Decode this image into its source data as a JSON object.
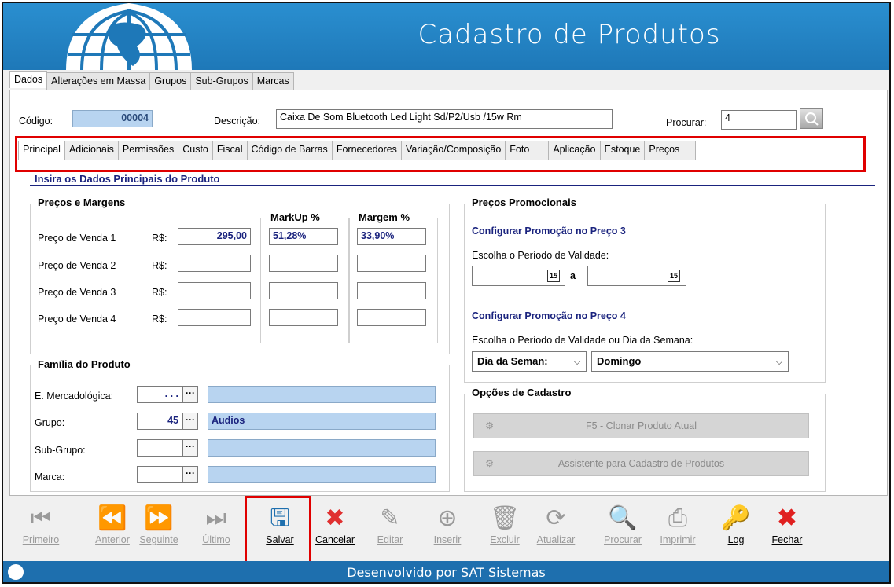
{
  "header": {
    "title": "Cadastro de Produtos"
  },
  "main_tabs": [
    "Dados",
    "Alterações em Massa",
    "Grupos",
    "Sub-Grupos",
    "Marcas"
  ],
  "form": {
    "codigo_label": "Código:",
    "codigo_value": "00004",
    "descricao_label": "Descrição:",
    "descricao_value": "Caixa De Som Bluetooth Led Light Sd/P2/Usb /15w Rm",
    "procurar_label": "Procurar:",
    "procurar_value": "4"
  },
  "sub_tabs": [
    "Principal",
    "Adicionais",
    "Permissões",
    "Custo",
    "Fiscal",
    "Código de Barras",
    "Fornecedores",
    "Variação/Composição",
    "Foto",
    "Aplicação",
    "Estoque",
    "Preços"
  ],
  "section_title": "Insira os Dados Principais do Produto",
  "precos": {
    "title": "Preços e Margens",
    "markup_header": "MarkUp %",
    "margem_header": "Margem %",
    "currency": "R$:",
    "rows": [
      {
        "label": "Preço de Venda 1",
        "value": "295,00",
        "markup": "51,28%",
        "margem": "33,90%"
      },
      {
        "label": "Preço de Venda 2",
        "value": "",
        "markup": "",
        "margem": ""
      },
      {
        "label": "Preço de Venda 3",
        "value": "",
        "markup": "",
        "margem": ""
      },
      {
        "label": "Preço de Venda 4",
        "value": "",
        "markup": "",
        "margem": ""
      }
    ]
  },
  "familia": {
    "title": "Família do Produto",
    "rows": [
      {
        "label": "E. Mercadológica:",
        "code": ". . .",
        "name": ""
      },
      {
        "label": "Grupo:",
        "code": "45",
        "name": "Audios"
      },
      {
        "label": "Sub-Grupo:",
        "code": "",
        "name": ""
      },
      {
        "label": "Marca:",
        "code": "",
        "name": ""
      }
    ]
  },
  "promo": {
    "title": "Preços Promocionais",
    "p3_title": "Configurar Promoção no Preço 3",
    "p3_label": "Escolha o Período de Validade:",
    "a_label": "a",
    "p4_title": "Configurar Promoção no Preço 4",
    "p4_label": "Escolha o Período de Validade ou Dia da Semana:",
    "select1": "Dia da Seman:",
    "select2": "Domingo",
    "cal_glyph": "15"
  },
  "opcoes": {
    "title": "Opções de Cadastro",
    "btn1": "F5 - Clonar Produto Atual",
    "btn2": "Assistente para Cadastro de Produtos"
  },
  "toolbar": [
    {
      "name": "primeiro",
      "label": "Primeiro",
      "icon": "⏮",
      "enabled": false
    },
    {
      "name": "anterior",
      "label": "Anterior",
      "icon": "⏪",
      "enabled": false
    },
    {
      "name": "seguinte",
      "label": "Seguinte",
      "icon": "⏩",
      "enabled": false
    },
    {
      "name": "ultimo",
      "label": "Último",
      "icon": "⏭",
      "enabled": false
    },
    {
      "name": "salvar",
      "label": "Salvar",
      "icon": "🖫",
      "enabled": true
    },
    {
      "name": "cancelar",
      "label": "Cancelar",
      "icon": "✖",
      "enabled": true
    },
    {
      "name": "editar",
      "label": "Editar",
      "icon": "✎",
      "enabled": false
    },
    {
      "name": "inserir",
      "label": "Inserir",
      "icon": "⊕",
      "enabled": false
    },
    {
      "name": "excluir",
      "label": "Excluir",
      "icon": "🗑",
      "enabled": false
    },
    {
      "name": "atualizar",
      "label": "Atualizar",
      "icon": "⟳",
      "enabled": false
    },
    {
      "name": "procurar",
      "label": "Procurar",
      "icon": "🔍",
      "enabled": false
    },
    {
      "name": "imprimir",
      "label": "Imprimir",
      "icon": "⎙",
      "enabled": false
    },
    {
      "name": "log",
      "label": "Log",
      "icon": "🔑",
      "enabled": true
    },
    {
      "name": "fechar",
      "label": "Fechar",
      "icon": "✖",
      "enabled": true
    }
  ],
  "footer": {
    "text": "Desenvolvido por SAT Sistemas"
  },
  "colors": {
    "header_blue": "#1e78b8",
    "highlight_red": "#e00000",
    "field_blue": "#b8d4f0",
    "navy": "#1a237e"
  }
}
